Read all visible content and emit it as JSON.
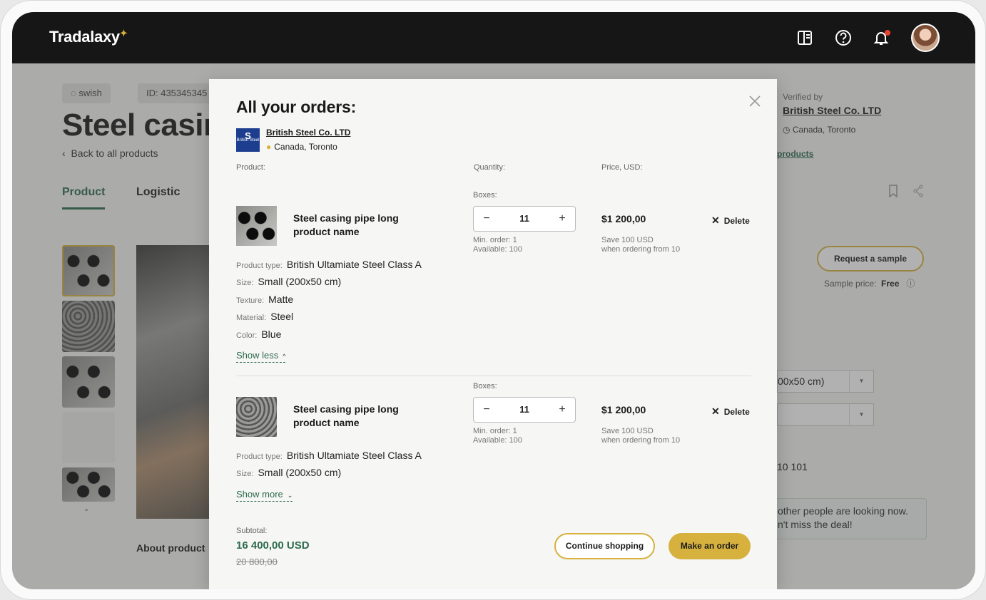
{
  "header": {
    "logo_text": "Tradalaxy",
    "logo_star": "✦",
    "icons": [
      "catalog-icon",
      "help-icon",
      "bell-icon"
    ]
  },
  "background": {
    "chip_brand": "swish",
    "chip_id": "ID: 435345345",
    "title": "Steel casin",
    "back_link": "Back to all products",
    "tabs": [
      "Product",
      "Logistic"
    ],
    "about": "About product",
    "verified_by_label": "Verified by",
    "verified_by_company": "British Steel Co. LTD",
    "verified_location": "Canada, Toronto",
    "products_link": "products",
    "request_sample": "Request a sample",
    "sample_price_label": "Sample price:",
    "sample_price_value": "Free",
    "size_select": "00x50 cm)",
    "second_select": "",
    "partial_number": "10 101",
    "alert_line1": "other people are looking now.",
    "alert_line2": "n't miss the deal!"
  },
  "modal": {
    "title": "All your orders:",
    "seller": {
      "name": "British Steel Co. LTD",
      "location": "Canada, Toronto",
      "logo_text": "British Steel"
    },
    "columns": {
      "product": "Product:",
      "quantity": "Quantity:",
      "price": "Price, USD:"
    },
    "items": [
      {
        "name": "Steel casing pipe long product name",
        "boxes_label": "Boxes:",
        "qty": "11",
        "min_order": "Min. order:  1",
        "available": "Available:  100",
        "price": "$1 200,00",
        "save_line1": "Save 100 USD",
        "save_line2": "when ordering from 10",
        "delete": "Delete",
        "attrs": [
          {
            "k": "Product type:",
            "v": "British Ultamiate Steel Class A"
          },
          {
            "k": "Size:",
            "v": "Small (200x50 cm)"
          },
          {
            "k": "Texture:",
            "v": "Matte"
          },
          {
            "k": "Material:",
            "v": "Steel"
          },
          {
            "k": "Color:",
            "v": "Blue"
          }
        ],
        "toggle": "Show less"
      },
      {
        "name": "Steel casing pipe long product name",
        "boxes_label": "Boxes:",
        "qty": "11",
        "min_order": "Min. order:  1",
        "available": "Available:  100",
        "price": "$1 200,00",
        "save_line1": "Save 100 USD",
        "save_line2": "when ordering from 10",
        "delete": "Delete",
        "attrs": [
          {
            "k": "Product type:",
            "v": "British Ultamiate Steel Class A"
          },
          {
            "k": "Size:",
            "v": "Small (200x50 cm)"
          }
        ],
        "toggle": "Show more"
      }
    ],
    "subtotal_label": "Subtotal:",
    "subtotal_value": "16 400,00 USD",
    "subtotal_old": "20 800,00",
    "continue_label": "Continue shopping",
    "order_label": "Make an order"
  },
  "colors": {
    "accent": "#d6b13e",
    "green": "#2d6b4d",
    "header": "#161616"
  }
}
